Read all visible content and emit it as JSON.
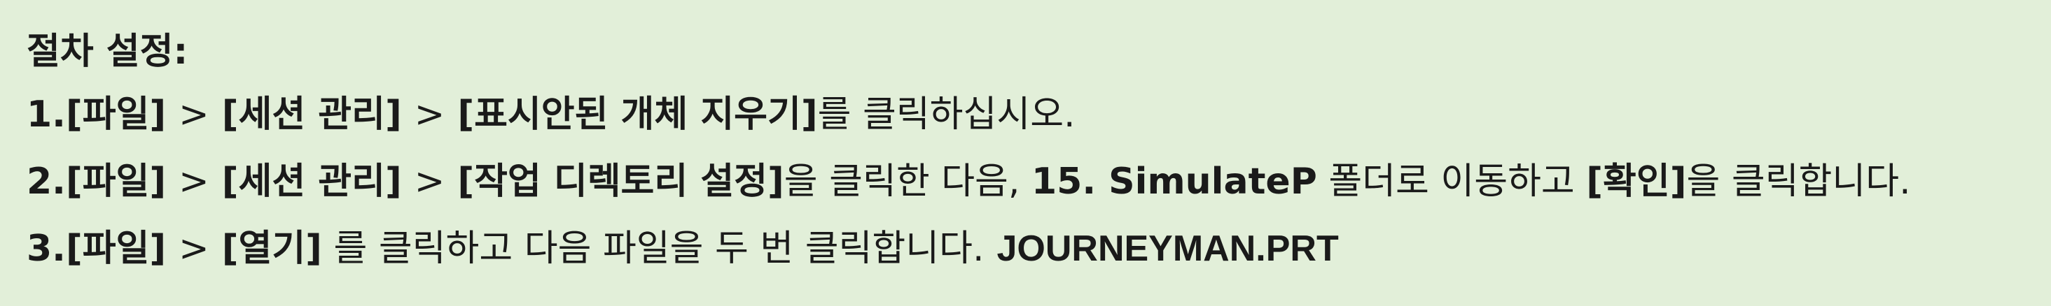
{
  "heading": "절차 설정:",
  "steps": [
    {
      "number": "1.",
      "path": [
        "[파일]",
        "[세션 관리]",
        "[표시안된 개체 지우기]"
      ],
      "tail": "를 클릭하십시오."
    },
    {
      "number": "2.",
      "path": [
        "[파일]",
        "[세션 관리]",
        "[작업 디렉토리 설정]"
      ],
      "tail_a": "을 클릭한 다음, ",
      "folder": "15. SimulateP",
      "tail_b": " 폴더로 이동하고 ",
      "confirm": "[확인]",
      "tail_c": "을 클릭합니다."
    },
    {
      "number": "3.",
      "path": [
        "[파일]",
        "[열기]"
      ],
      "tail": " 를 클릭하고 다음 파일을 두 번 클릭합니다.",
      "filename": "JOURNEYMAN.PRT"
    }
  ],
  "separator": ">",
  "colors": {
    "background": "#e2efd9",
    "text": "#1a1a1a"
  }
}
